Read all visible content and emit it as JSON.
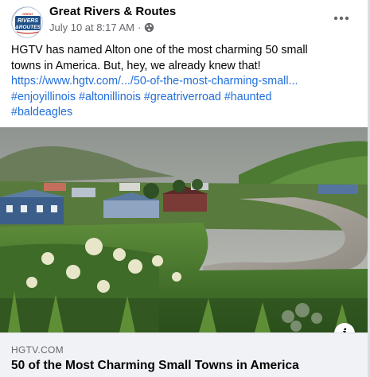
{
  "post": {
    "page_name": "Great Rivers & Routes",
    "date": "July 10 at 8:17 AM",
    "separator": "·",
    "privacy_icon": "globe-icon",
    "avatar_text_top": "RIVERS",
    "avatar_text_bottom": "&ROUTES",
    "avatar_text_small": "GREAT",
    "more_icon": "more-horizontal-icon",
    "text_line1": "HGTV has named Alton one of the most charming 50 small",
    "text_line2": "towns in America. But, hey, we already knew that!",
    "url": "https://www.hgtv.com/.../50-of-the-most-charming-small...",
    "hashtags_line1": [
      "#enjoyillinois",
      "#altonillinois",
      "#greatriverroad",
      "#haunted"
    ],
    "hashtags_line2": [
      "#baldeagles"
    ]
  },
  "link_preview": {
    "domain": "HGTV.COM",
    "title": "50 of the Most Charming Small Towns in America",
    "info_label": "i",
    "image_subject": "coastal-town-river-landscape"
  },
  "colors": {
    "link": "#216fdb",
    "secondary_text": "#65676b",
    "footer_bg": "#f0f2f5"
  }
}
